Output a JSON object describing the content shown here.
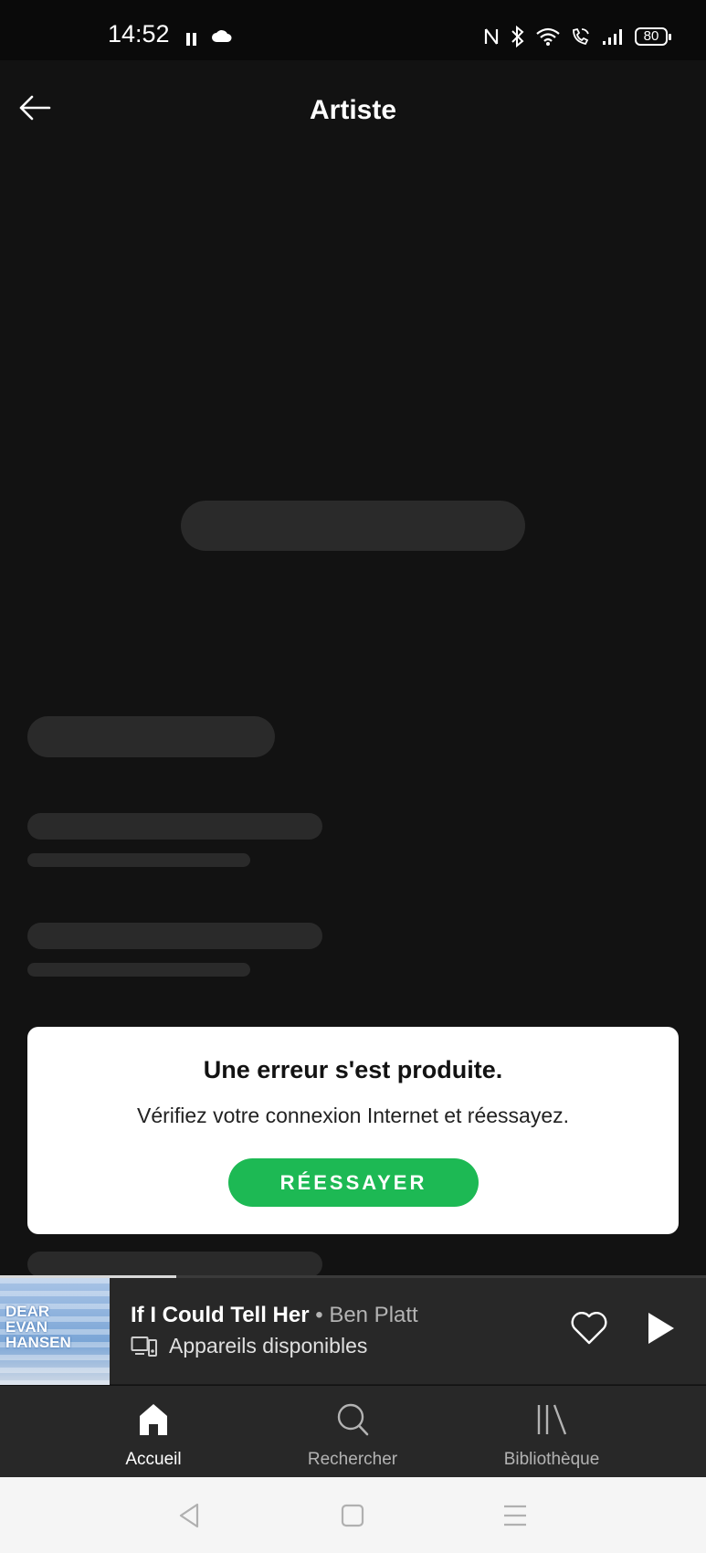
{
  "status_bar": {
    "time": "14:52",
    "battery": "80"
  },
  "header": {
    "title": "Artiste"
  },
  "error": {
    "title": "Une erreur s'est produite.",
    "message": "Vérifiez votre connexion Internet et réessayez.",
    "retry_label": "RÉESSAYER"
  },
  "player": {
    "track_title": "If I Could Tell Her",
    "separator": " • ",
    "artist": "Ben Platt",
    "devices_label": "Appareils disponibles",
    "album_art_text": "DEAR EVAN HANSEN",
    "progress": 0.25,
    "liked": false
  },
  "nav": {
    "items": [
      {
        "label": "Accueil",
        "icon": "home-icon",
        "active": true
      },
      {
        "label": "Rechercher",
        "icon": "search-icon",
        "active": false
      },
      {
        "label": "Bibliothèque",
        "icon": "library-icon",
        "active": false
      }
    ]
  },
  "colors": {
    "background": "#121212",
    "accent": "#1db954",
    "surface": "#282828"
  }
}
